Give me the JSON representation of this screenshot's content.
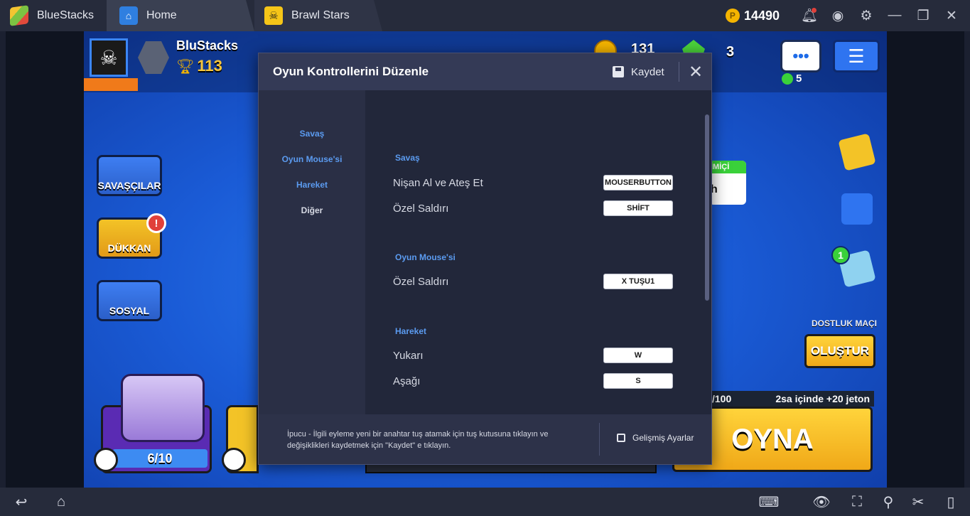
{
  "titlebar": {
    "app_name": "BlueStacks",
    "tabs": [
      {
        "label": "Home"
      },
      {
        "label": "Brawl Stars"
      }
    ],
    "coins": "14490"
  },
  "game": {
    "player_name": "BluStacks",
    "trophies": "113",
    "hud_coins": "131",
    "hud_gems": "3",
    "friends_online": "5",
    "side_buttons": {
      "brawlers": "SAVAŞÇILAR",
      "shop": "DÜKKAN",
      "social": "SOSYAL"
    },
    "shop_alert": "!",
    "quest_badge": "1",
    "event_card_header": "İMİÇİ",
    "event_card_text": "h",
    "friendly_match_label": "DOSTLUK MAÇI",
    "create_button": "OLUŞTUR",
    "progress_text": "/100",
    "token_info": "2sa içinde +20 jeton",
    "play_button": "OYNA",
    "box_progress": "6/10"
  },
  "dialog": {
    "title": "Oyun Kontrollerini Düzenle",
    "save_label": "Kaydet",
    "nav": [
      {
        "label": "Savaş"
      },
      {
        "label": "Oyun Mouse'si"
      },
      {
        "label": "Hareket"
      },
      {
        "label": "Diğer"
      }
    ],
    "sections": [
      {
        "title": "Savaş",
        "rows": [
          {
            "label": "Nişan Al ve Ateş Et",
            "key": "MOUSERBUTTON"
          },
          {
            "label": "Özel Saldırı",
            "key": "SHİFT"
          }
        ]
      },
      {
        "title": "Oyun Mouse'si",
        "rows": [
          {
            "label": "Özel Saldırı",
            "key": "X TUŞU1"
          }
        ]
      },
      {
        "title": "Hareket",
        "rows": [
          {
            "label": "Yukarı",
            "key": "W"
          },
          {
            "label": "Aşağı",
            "key": "S"
          }
        ]
      }
    ],
    "tip": "İpucu - İlgili eyleme yeni bir anahtar tuş atamak için tuş kutusuna tıklayın ve değişiklikleri kaydetmek için \"Kaydet\" e tıklayın.",
    "advanced_label": "Gelişmiş Ayarlar"
  },
  "icons": {
    "titlebar": [
      "bluestacks-logo-icon",
      "home-icon",
      "brawl-stars-icon",
      "coin-icon",
      "bell-icon",
      "account-icon",
      "gear-icon",
      "minimize-icon",
      "restore-icon",
      "close-icon"
    ],
    "bottombar": [
      "back-icon",
      "home-icon",
      "keyboard-icon",
      "eye-icon",
      "fullscreen-icon",
      "location-icon",
      "scissors-icon",
      "phone-icon"
    ]
  }
}
